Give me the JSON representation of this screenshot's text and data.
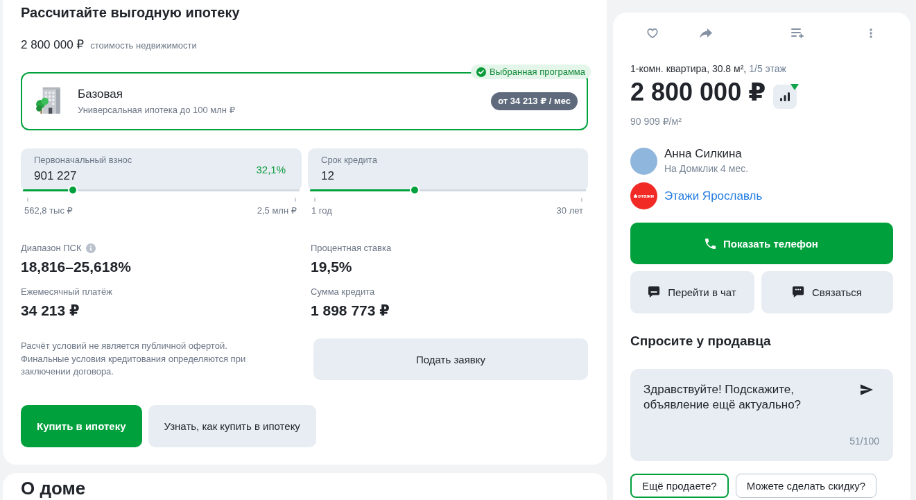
{
  "mortgage_calculator": {
    "title": "Рассчитайте выгодную ипотеку",
    "property_price": {
      "value": "2 800 000 ₽",
      "label": "стоимость недвижимости"
    },
    "program": {
      "selected": true,
      "badge": "Выбранная программа",
      "name": "Базовая",
      "description": "Универсальная ипотека до 100 млн ₽",
      "monthly": "от 34 213 ₽ / мес"
    },
    "sliders": [
      {
        "label": "Первоначальный взнос",
        "value": "901 227",
        "share": "32,1%",
        "level": 0.18,
        "min_label": "562,8 тыс ₽",
        "max_label": "2,5 млн ₽"
      },
      {
        "label": "Срок кредита",
        "value": "12",
        "level": 0.38,
        "min_label": "1 год",
        "max_label": "30 лет"
      }
    ],
    "stats": [
      {
        "label": "Диапазон ПСК",
        "value": "18,816–25,618%",
        "has_info": true
      },
      {
        "label": "Процентная ставка",
        "value": "19,5%"
      },
      {
        "label": "Ежемесячный платёж",
        "value": "34 213 ₽"
      },
      {
        "label": "Сумма кредита",
        "value": "1 898 773 ₽"
      }
    ],
    "disclaimer": "Расчёт условий не является публичной офертой. Финальные условия кредитования определяются при заключении договора.",
    "apply_button": "Подать заявку",
    "buttons": [
      {
        "label": "Купить в ипотеку",
        "kind": "primary"
      },
      {
        "label": "Узнать, как купить в ипотеку",
        "kind": "secondary"
      }
    ]
  },
  "about_section": {
    "title": "О доме"
  },
  "listing": {
    "summary": "1-комн. квартира, 30.8 м²,",
    "floor": "1/5 этаж",
    "price": "2 800 000 ₽",
    "price_dropped": true,
    "price_per_m2": "90 909 ₽/м²",
    "seller": {
      "name": "Анна Силкина",
      "tenure": "На Домклик 4 мес."
    },
    "agency": {
      "logo_text": "этажи",
      "name": "Этажи Ярославль"
    },
    "phone_button": "Показать телефон",
    "secondary_buttons": [
      {
        "label": "Перейти в чат",
        "kind": "chat"
      },
      {
        "label": "Связаться",
        "kind": "contact"
      }
    ],
    "ask": {
      "title": "Спросите у продавца",
      "message": "Здравствуйте! Подскажите, объявление ещё актуально?",
      "counter": "51/100",
      "suggestions": [
        {
          "label": "Ещё продаете?",
          "selected": true
        },
        {
          "label": "Можете сделать скидку?",
          "selected": false
        }
      ]
    }
  }
}
